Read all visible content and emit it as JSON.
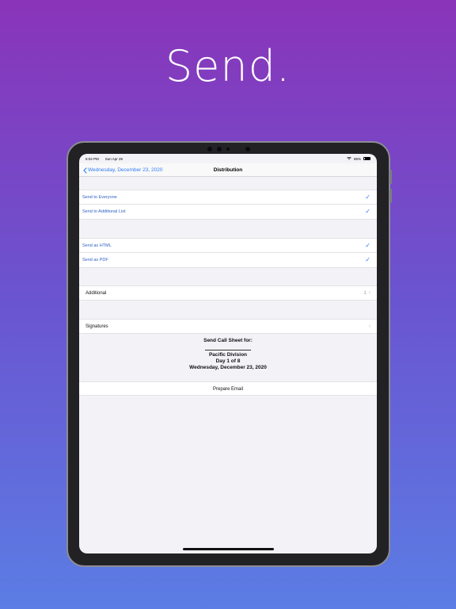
{
  "headline": "Send.",
  "status_bar": {
    "time": "6:04 PM",
    "date": "Sun Apr 26",
    "battery": "85%"
  },
  "nav": {
    "back_label": "Wednesday, December 23, 2020",
    "title": "Distribution"
  },
  "recipients": [
    {
      "label": "Send to Everyone",
      "checked": true
    },
    {
      "label": "Send to Additional List",
      "checked": true
    }
  ],
  "formats": [
    {
      "label": "Send as HTML",
      "checked": true
    },
    {
      "label": "Send as PDF",
      "checked": true
    }
  ],
  "additional": {
    "label": "Additional",
    "count": "1"
  },
  "signatures": {
    "label": "Signatures"
  },
  "summary": {
    "title": "Send Call Sheet for:",
    "division": "Pacific Division",
    "day": "Day 1 of 8",
    "date": "Wednesday, December 23, 2020"
  },
  "prepare_email": "Prepare Email",
  "colors": {
    "accent": "#2f7bf5",
    "gradient_top": "#8a34b9",
    "gradient_bottom": "#5b7de4"
  }
}
